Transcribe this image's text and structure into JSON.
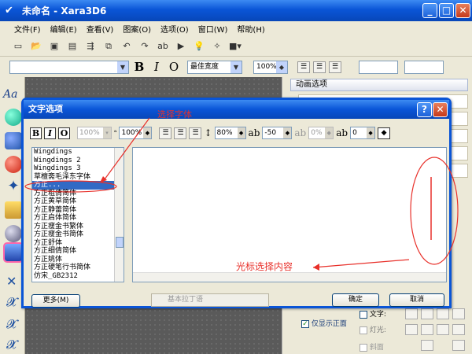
{
  "window": {
    "title": "未命名 - Xara3D6",
    "min": "_",
    "max": "□",
    "close": "✕"
  },
  "menu": [
    "文件(F)",
    "编辑(E)",
    "查看(V)",
    "图案(O)",
    "选项(O)",
    "窗口(W)",
    "帮助(H)"
  ],
  "toolbar2": {
    "font_width": "最佳宽度",
    "zoom": "100%",
    "bold": "B",
    "italic": "I",
    "outline": "O"
  },
  "panel": {
    "title": "动画选项"
  },
  "dialog": {
    "title": "文字选项",
    "help": "?",
    "close": "✕",
    "style_buttons": [
      "B",
      "I",
      "O"
    ],
    "size_disabled": "100%",
    "width_value": "100%",
    "line_spacing": "80%",
    "char_spacing": "-50",
    "baseline": "0%",
    "kerning": "0",
    "fonts": [
      "Wingdings",
      "Wingdings 2",
      "Wingdings 3",
      "草檀斋毛泽东字体",
      "方正...",
      "方正粗倩简体",
      "方正黄草简体",
      "方正静蕾简体",
      "方正启体简体",
      "方正瘦金书繁体",
      "方正瘦金书简体",
      "方正舒体",
      "方正细倩简体",
      "方正姚体",
      "方正硬笔行书简体",
      "仿宋_GB2312"
    ],
    "selected_font_index": 4,
    "more_button": "更多(M)",
    "combo_disabled": "基本拉丁语",
    "ok_button": "确定",
    "cancel_button": "取消"
  },
  "annotations": {
    "pick_font": "选择字体",
    "cursor_select": "光标选择内容"
  },
  "lower_panel": {
    "text_label": "文字:",
    "light_label": "灯光:",
    "show_front": "仅显示正面",
    "bevel": "斜面"
  }
}
